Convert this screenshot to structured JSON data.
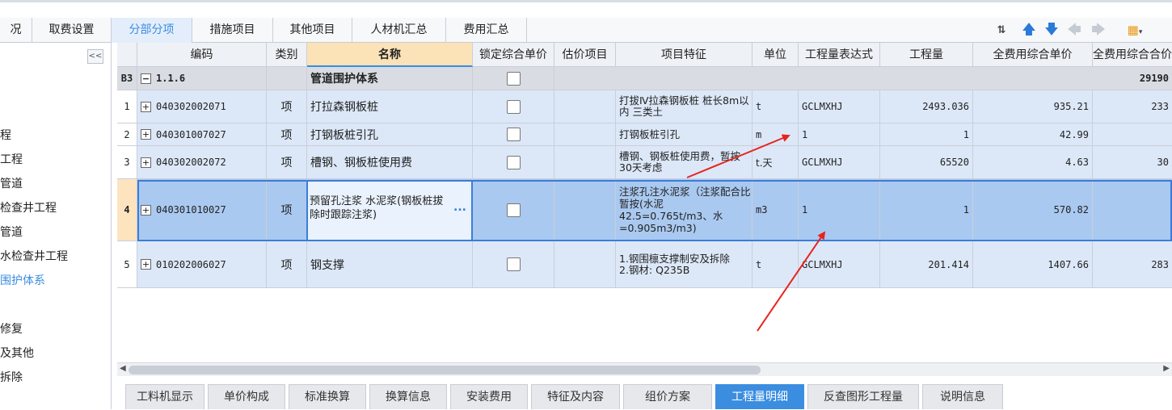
{
  "top_tabs": [
    {
      "label": "况",
      "active": false
    },
    {
      "label": "取费设置",
      "active": false
    },
    {
      "label": "分部分项",
      "active": true
    },
    {
      "label": "措施项目",
      "active": false
    },
    {
      "label": "其他项目",
      "active": false
    },
    {
      "label": "人材机汇总",
      "active": false
    },
    {
      "label": "费用汇总",
      "active": false
    }
  ],
  "toolbar_icons": [
    "sort-icon",
    "arrow-up-icon",
    "arrow-down-icon",
    "arrow-left-icon",
    "arrow-right-icon",
    "settings-dropdown-icon"
  ],
  "sidebar": {
    "collapse_label": "<<",
    "items": [
      {
        "label": "程",
        "active": false
      },
      {
        "label": "工程",
        "active": false
      },
      {
        "label": "管道",
        "active": false
      },
      {
        "label": "检查井工程",
        "active": false
      },
      {
        "label": "管道",
        "active": false
      },
      {
        "label": "水检查井工程",
        "active": false
      },
      {
        "label": "围护体系",
        "active": true
      },
      {
        "label": "修复",
        "active": false
      },
      {
        "label": "及其他",
        "active": false
      },
      {
        "label": "拆除",
        "active": false
      }
    ]
  },
  "columns": [
    "编码",
    "类别",
    "名称",
    "锁定综合单价",
    "估价项目",
    "项目特征",
    "单位",
    "工程量表达式",
    "工程量",
    "全费用综合单价",
    "全费用综合合价"
  ],
  "group_row": {
    "id": "B3",
    "code": "1.1.6",
    "name": "管道围护体系",
    "total": "29190"
  },
  "rows": [
    {
      "num": "1",
      "code": "040302002071",
      "type": "项",
      "name": "打拉森钢板桩",
      "feature": "打拔Ⅳ拉森钢板桩 桩长8m以内 三类土",
      "unit": "t",
      "expr": "GCLMXHJ",
      "qty": "2493.036",
      "price": "935.21",
      "total": "233"
    },
    {
      "num": "2",
      "code": "040301007027",
      "type": "项",
      "name": "打钢板桩引孔",
      "feature": "打钢板桩引孔",
      "unit": "m",
      "expr": "1",
      "qty": "1",
      "price": "42.99",
      "total": ""
    },
    {
      "num": "3",
      "code": "040302002072",
      "type": "项",
      "name": "槽钢、钢板桩使用费",
      "feature": "槽钢、钢板桩使用费，暂按30天考虑",
      "unit": "t.天",
      "expr": "GCLMXHJ",
      "qty": "65520",
      "price": "4.63",
      "total": "30"
    },
    {
      "num": "4",
      "code": "040301010027",
      "type": "项",
      "name": "预留孔注浆 水泥浆(钢板桩拔除时跟踪注浆)",
      "feature": "注浆孔注水泥浆（注浆配合比暂按(水泥42.5=0.765t/m3、水=0.905m3/m3)",
      "unit": "m3",
      "expr": "1",
      "qty": "1",
      "price": "570.82",
      "total": "",
      "selected": true
    },
    {
      "num": "5",
      "code": "010202006027",
      "type": "项",
      "name": "钢支撑",
      "feature": "1.钢围檩支撑制安及拆除\n2.钢材: Q235B",
      "unit": "t",
      "expr": "GCLMXHJ",
      "qty": "201.414",
      "price": "1407.66",
      "total": "283"
    }
  ],
  "ellipsis": "...",
  "bottom_tabs": [
    {
      "label": "工料机显示",
      "active": false
    },
    {
      "label": "单价构成",
      "active": false
    },
    {
      "label": "标准换算",
      "active": false
    },
    {
      "label": "换算信息",
      "active": false
    },
    {
      "label": "安装费用",
      "active": false
    },
    {
      "label": "特征及内容",
      "active": false
    },
    {
      "label": "组价方案",
      "active": false
    },
    {
      "label": "工程量明细",
      "active": true
    },
    {
      "label": "反查图形工程量",
      "active": false
    },
    {
      "label": "说明信息",
      "active": false
    }
  ],
  "colors": {
    "accent": "#3b8de0",
    "selected_row": "#aac9f0",
    "annotation_arrow": "#e8231d"
  }
}
